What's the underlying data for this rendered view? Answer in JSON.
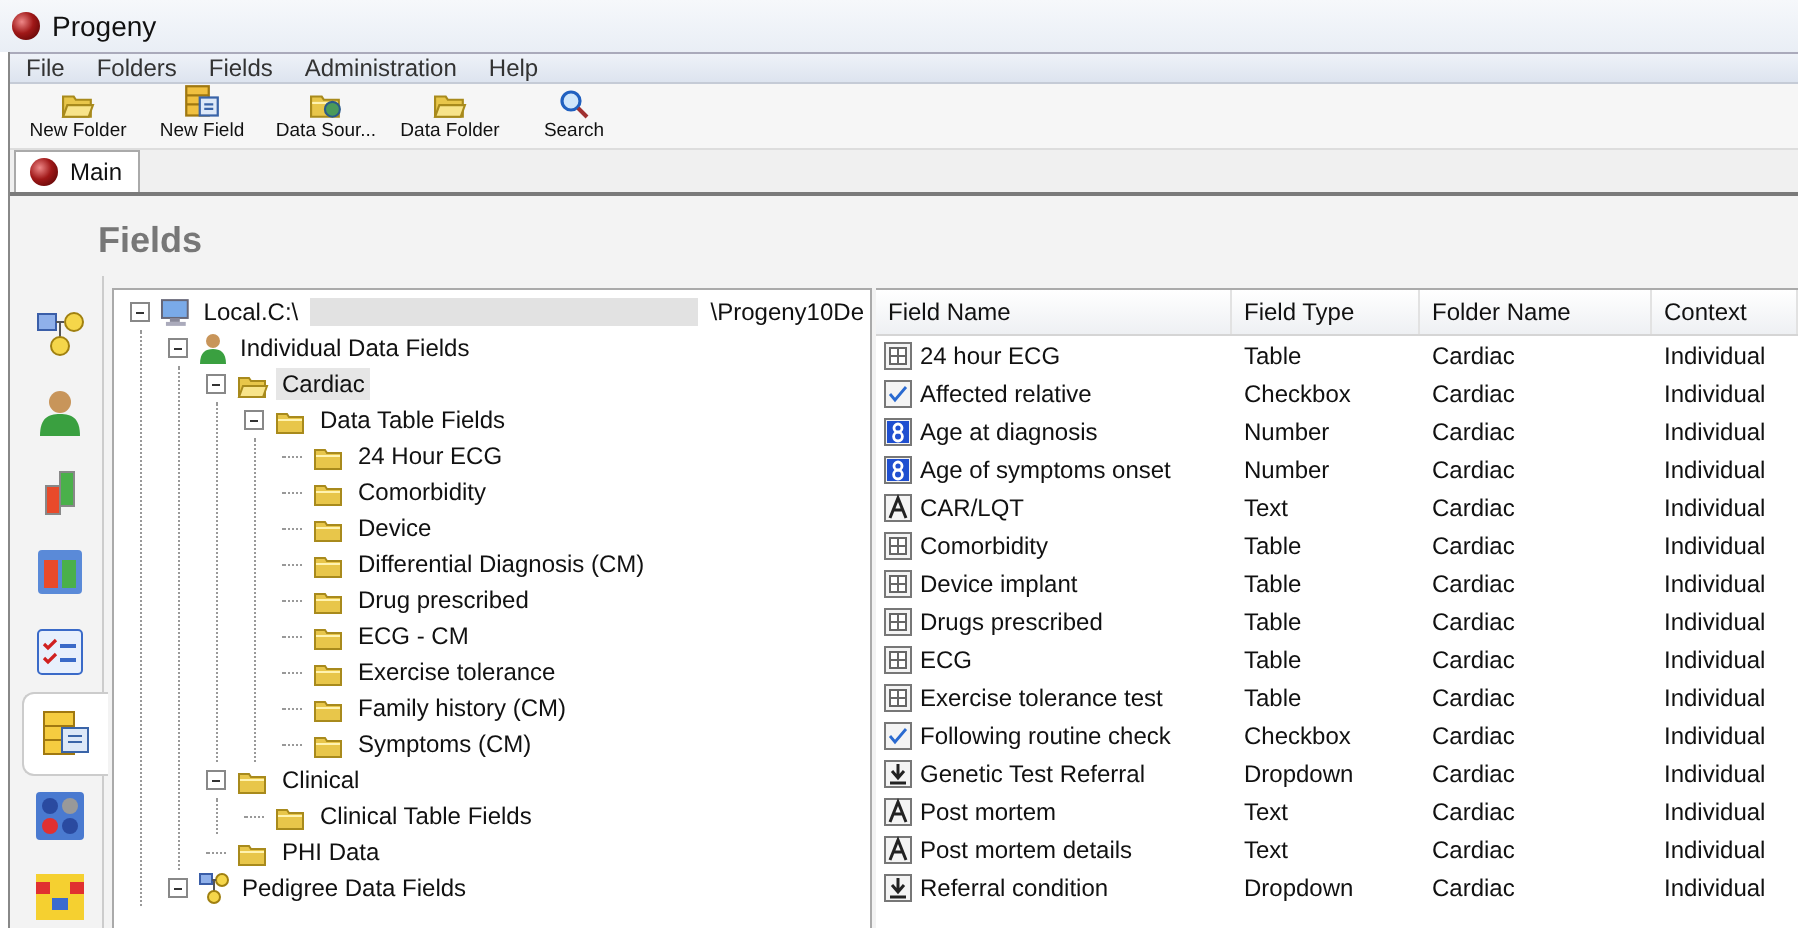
{
  "window": {
    "title": "Progeny"
  },
  "menu": [
    "File",
    "Folders",
    "Fields",
    "Administration",
    "Help"
  ],
  "toolbar": [
    {
      "label": "New Folder",
      "kind": "folder"
    },
    {
      "label": "New Field",
      "kind": "field"
    },
    {
      "label": "Data Sour...",
      "kind": "source"
    },
    {
      "label": "Data Folder",
      "kind": "folder"
    },
    {
      "label": "Search",
      "kind": "search"
    }
  ],
  "tabs": [
    {
      "label": "Main",
      "selected": true
    }
  ],
  "page_title": "Fields",
  "nav_icons": [
    {
      "kind": "pedigree",
      "selected": false
    },
    {
      "kind": "person",
      "selected": false
    },
    {
      "kind": "bars",
      "selected": false
    },
    {
      "kind": "panel",
      "selected": false
    },
    {
      "kind": "checklist",
      "selected": false
    },
    {
      "kind": "fields",
      "selected": true
    },
    {
      "kind": "dots",
      "selected": false
    },
    {
      "kind": "grid",
      "selected": false
    }
  ],
  "tree": {
    "label_start": "Local.C:\\",
    "label_end": "\\Progeny10De",
    "kind": "computer",
    "expanded": true,
    "children": [
      {
        "label": "Individual Data Fields",
        "kind": "person",
        "expanded": true,
        "selected": false,
        "children": [
          {
            "label": "Cardiac",
            "kind": "folder",
            "expanded": true,
            "selected": true,
            "children": [
              {
                "label": "Data Table Fields",
                "kind": "folder",
                "expanded": true,
                "selected": false,
                "children": [
                  {
                    "label": "24 Hour ECG",
                    "kind": "folder",
                    "selected": false
                  },
                  {
                    "label": "Comorbidity",
                    "kind": "folder",
                    "selected": false
                  },
                  {
                    "label": "Device",
                    "kind": "folder",
                    "selected": false
                  },
                  {
                    "label": "Differential Diagnosis (CM)",
                    "kind": "folder",
                    "selected": false
                  },
                  {
                    "label": "Drug prescribed",
                    "kind": "folder",
                    "selected": false
                  },
                  {
                    "label": "ECG - CM",
                    "kind": "folder",
                    "selected": false
                  },
                  {
                    "label": "Exercise tolerance",
                    "kind": "folder",
                    "selected": false
                  },
                  {
                    "label": "Family history (CM)",
                    "kind": "folder",
                    "selected": false
                  },
                  {
                    "label": "Symptoms (CM)",
                    "kind": "folder",
                    "selected": false
                  }
                ]
              }
            ]
          },
          {
            "label": "Clinical",
            "kind": "folder",
            "expanded": true,
            "selected": false,
            "children": [
              {
                "label": "Clinical Table Fields",
                "kind": "folder",
                "selected": false
              }
            ]
          },
          {
            "label": "PHI Data",
            "kind": "folder",
            "selected": false
          }
        ]
      },
      {
        "label": "Pedigree Data Fields",
        "kind": "pedigree",
        "expanded": true,
        "selected": false
      }
    ]
  },
  "table": {
    "columns": [
      "Field Name",
      "Field Type",
      "Folder Name",
      "Context"
    ],
    "rows": [
      {
        "kind": "table",
        "name": "24 hour ECG",
        "type": "Table",
        "folder": "Cardiac",
        "context": "Individual"
      },
      {
        "kind": "checkbox",
        "name": "Affected relative",
        "type": "Checkbox",
        "folder": "Cardiac",
        "context": "Individual"
      },
      {
        "kind": "number",
        "name": "Age at diagnosis",
        "type": "Number",
        "folder": "Cardiac",
        "context": "Individual"
      },
      {
        "kind": "number",
        "name": "Age of symptoms onset",
        "type": "Number",
        "folder": "Cardiac",
        "context": "Individual"
      },
      {
        "kind": "text",
        "name": "CAR/LQT",
        "type": "Text",
        "folder": "Cardiac",
        "context": "Individual"
      },
      {
        "kind": "table",
        "name": "Comorbidity",
        "type": "Table",
        "folder": "Cardiac",
        "context": "Individual"
      },
      {
        "kind": "table",
        "name": "Device implant",
        "type": "Table",
        "folder": "Cardiac",
        "context": "Individual"
      },
      {
        "kind": "table",
        "name": "Drugs prescribed",
        "type": "Table",
        "folder": "Cardiac",
        "context": "Individual"
      },
      {
        "kind": "table",
        "name": "ECG",
        "type": "Table",
        "folder": "Cardiac",
        "context": "Individual"
      },
      {
        "kind": "table",
        "name": "Exercise tolerance test",
        "type": "Table",
        "folder": "Cardiac",
        "context": "Individual"
      },
      {
        "kind": "checkbox",
        "name": "Following routine check",
        "type": "Checkbox",
        "folder": "Cardiac",
        "context": "Individual"
      },
      {
        "kind": "dropdown",
        "name": "Genetic Test Referral",
        "type": "Dropdown",
        "folder": "Cardiac",
        "context": "Individual"
      },
      {
        "kind": "text",
        "name": "Post mortem",
        "type": "Text",
        "folder": "Cardiac",
        "context": "Individual"
      },
      {
        "kind": "text",
        "name": "Post mortem details",
        "type": "Text",
        "folder": "Cardiac",
        "context": "Individual"
      },
      {
        "kind": "dropdown",
        "name": "Referral condition",
        "type": "Dropdown",
        "folder": "Cardiac",
        "context": "Individual"
      }
    ]
  }
}
